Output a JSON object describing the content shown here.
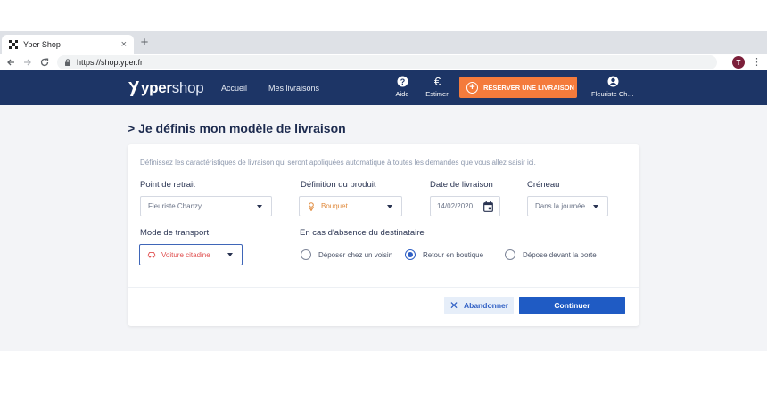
{
  "browser": {
    "tab_title": "Yper Shop",
    "tab_close": "×",
    "new_tab": "+",
    "url": "https://shop.yper.fr",
    "profile_initial": "T"
  },
  "header": {
    "logo_bold": "yper",
    "logo_light": "shop",
    "nav": [
      "Accueil",
      "Mes livraisons"
    ],
    "help_label": "Aide",
    "estimate_label": "Estimer",
    "reserve_label": "RÉSERVER UNE LIVRAISON",
    "account_label": "Fleuriste Ch…",
    "colors": {
      "header_bg": "#1d3566",
      "accent_orange": "#f47b3c"
    }
  },
  "page": {
    "title": "> Je définis mon modèle de livraison",
    "intro": "Définissez les caractéristiques de livraison qui seront appliquées automatique à toutes les demandes que vous allez saisir ici."
  },
  "form": {
    "pickup": {
      "label": "Point de retrait",
      "value": "Fleuriste Chanzy"
    },
    "product": {
      "label": "Définition du produit",
      "value": "Bouquet",
      "icon": "bouquet-icon"
    },
    "date": {
      "label": "Date de livraison",
      "value": "14/02/2020"
    },
    "slot": {
      "label": "Créneau",
      "value": "Dans la journée"
    },
    "transport": {
      "label": "Mode de transport",
      "value": "Voiture citadine",
      "icon": "car-icon"
    },
    "absence": {
      "label": "En cas d'absence du destinataire",
      "options": [
        {
          "label": "Déposer chez un voisin",
          "selected": false
        },
        {
          "label": "Retour en boutique",
          "selected": true
        },
        {
          "label": "Dépose devant la porte",
          "selected": false
        }
      ]
    }
  },
  "actions": {
    "abandon": "Abandonner",
    "continue": "Continuer"
  }
}
